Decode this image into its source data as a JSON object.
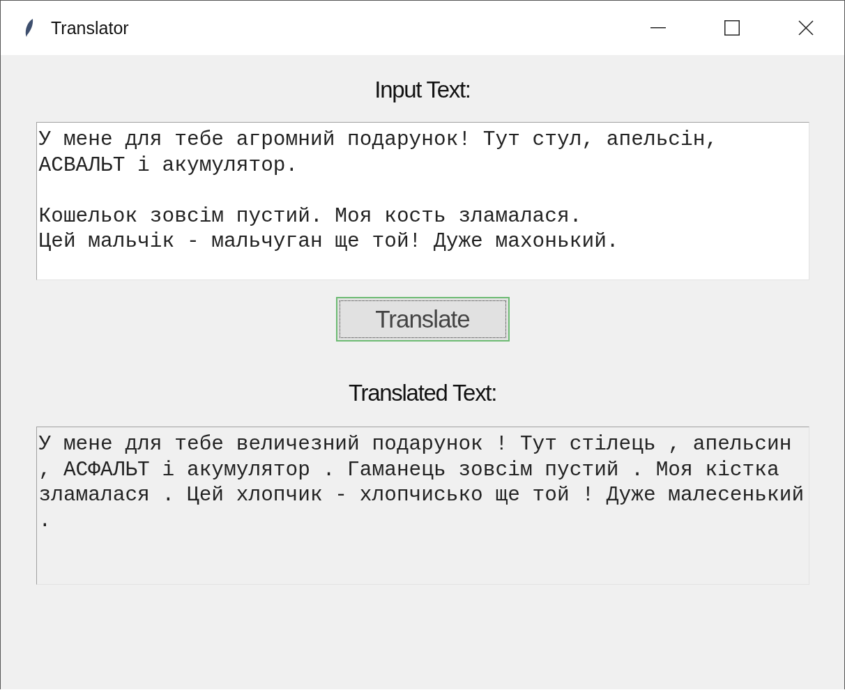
{
  "window": {
    "title": "Translator"
  },
  "input": {
    "label": "Input Text:",
    "value": "У мене для тебе агромний подарунок! Тут стул, апельсін, АСВАЛЬТ і акумулятор.\n\nКошельок зовсім пустий. Моя кость зламалася.\nЦей мальчік - мальчуган ще той! Дуже махонький."
  },
  "button": {
    "label": "Translate"
  },
  "output": {
    "label": "Translated Text:",
    "value": "У мене для тебе величезний подарунок ! Тут стілець , апельсин , АСФАЛЬТ і акумулятор . Гаманець зовсім пустий . Моя кістка зламалася . Цей хлопчик - хлопчисько ще той ! Дуже малесенький ."
  }
}
